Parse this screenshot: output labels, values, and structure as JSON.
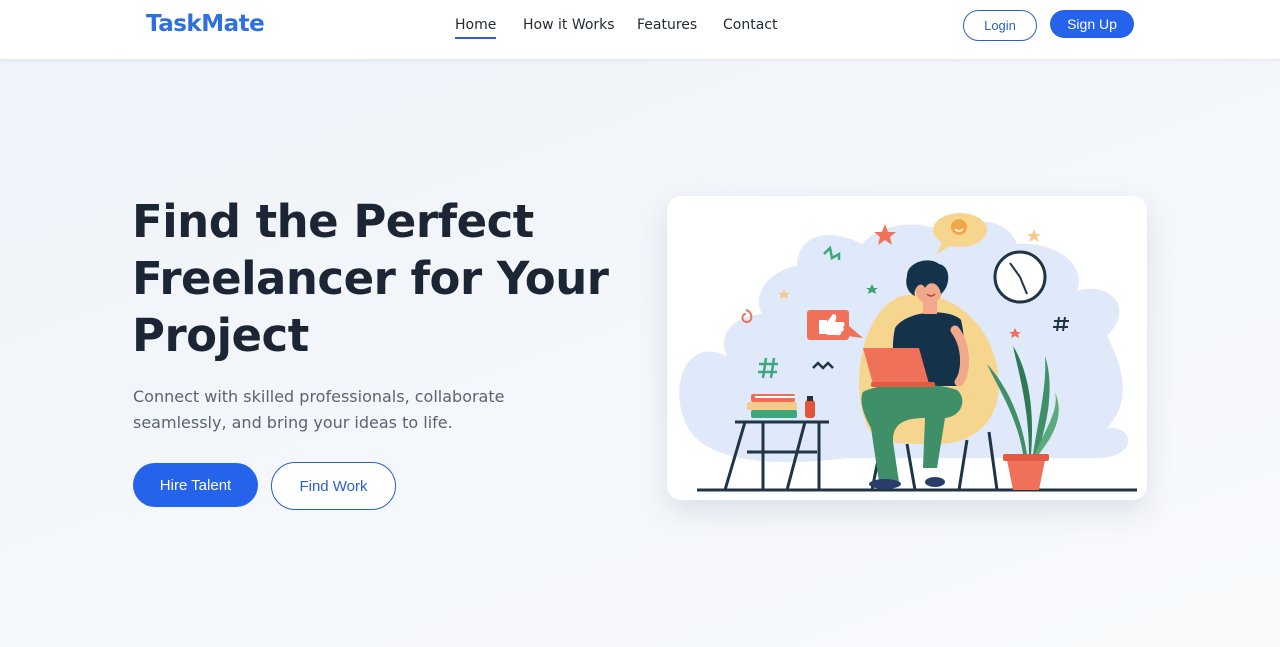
{
  "brand": {
    "name": "TaskMate"
  },
  "nav": {
    "links": [
      {
        "label": "Home",
        "active": true
      },
      {
        "label": "How it Works",
        "active": false
      },
      {
        "label": "Features",
        "active": false
      },
      {
        "label": "Contact",
        "active": false
      }
    ],
    "login_label": "Login",
    "signup_label": "Sign Up"
  },
  "hero": {
    "title_lines": [
      "Find the Perfect",
      "Freelancer for Your",
      "Project"
    ],
    "subtitle_lines": [
      "Connect with skilled professionals, collaborate",
      "seamlessly, and bring your ideas to life."
    ],
    "primary_cta": "Hire Talent",
    "secondary_cta": "Find Work"
  },
  "illustration": {
    "icons": [
      "person-with-laptop-icon",
      "clock-icon",
      "plant-icon",
      "books-icon",
      "thumbs-up-icon",
      "chat-bubble-icon",
      "star-icon",
      "hashtag-icon"
    ]
  },
  "colors": {
    "brand": "#2f6fe0",
    "primary": "#2563eb",
    "text_dark": "#1c2533",
    "text_muted": "#5b6472",
    "blob": "#dfe9f9",
    "accent_orange": "#f06c52",
    "accent_green": "#3f9a6a"
  }
}
